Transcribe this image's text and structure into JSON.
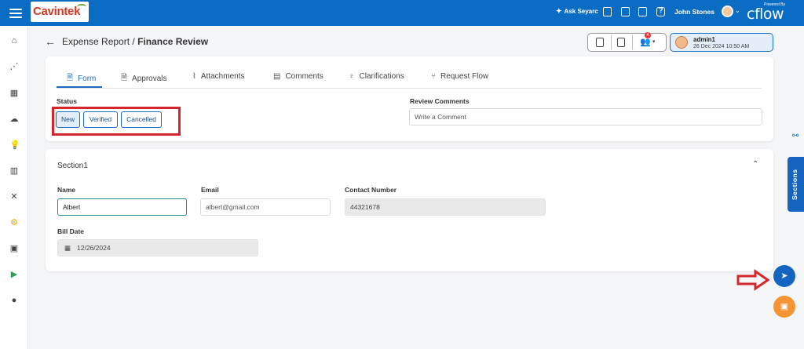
{
  "app": {
    "brand": "Cavintek",
    "ask_label": "Ask Seyarc",
    "user_name": "John Stones",
    "powered_by": "Powered By",
    "product": "cflow"
  },
  "header": {
    "breadcrumb_parent": "Expense Report",
    "breadcrumb_sep": " / ",
    "breadcrumb_current": "Finance Review",
    "notification_count": "4",
    "admin_name": "admin1",
    "admin_date": "26 Dec 2024 10:50 AM"
  },
  "tabs": [
    {
      "label": "Form",
      "icon": "file-icon",
      "active": true
    },
    {
      "label": "Approvals",
      "icon": "file-check-icon"
    },
    {
      "label": "Attachments",
      "icon": "paperclip-icon"
    },
    {
      "label": "Comments",
      "icon": "comment-icon"
    },
    {
      "label": "Clarifications",
      "icon": "lightbulb-icon"
    },
    {
      "label": "Request Flow",
      "icon": "flow-icon"
    }
  ],
  "status": {
    "label": "Status",
    "options": [
      "New",
      "Verified",
      "Cancelled"
    ],
    "selected": "New"
  },
  "review": {
    "label": "Review Comments",
    "placeholder": "Write a Comment"
  },
  "section": {
    "title": "Section1",
    "fields": {
      "name_label": "Name",
      "name_value": "Albert",
      "email_label": "Email",
      "email_value": "albert@gmail.com",
      "contact_label": "Contact Number",
      "contact_value": "44321678",
      "bill_label": "Bill Date",
      "bill_value": "12/26/2024"
    }
  },
  "right_panel": {
    "sections_label": "Sections"
  },
  "colors": {
    "topbar": "#0b6cc4",
    "accent": "#1a6cc2",
    "highlight_frame": "#d5262d",
    "save_fab": "#f49433"
  }
}
